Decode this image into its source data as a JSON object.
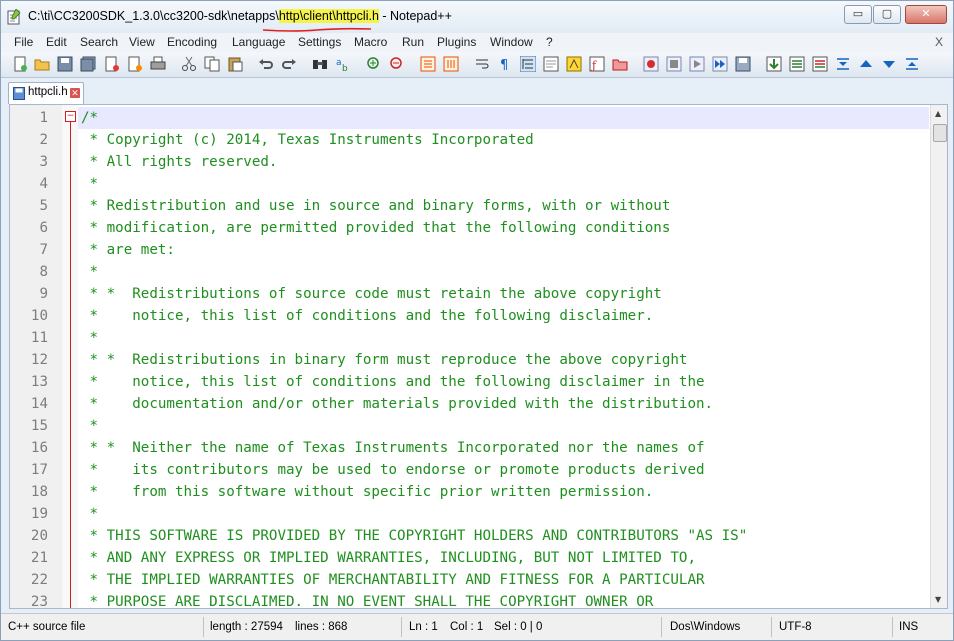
{
  "window": {
    "title_prefix": "C:\\ti\\CC3200SDK_1.3.0\\cc3200-sdk\\netapps\\",
    "title_highlight": "http\\client\\httpcli.h",
    "title_suffix": " - Notepad++",
    "controls": {
      "minimize": "▭",
      "maximize": "▢",
      "close": "✕"
    }
  },
  "menu": {
    "items": [
      "File",
      "Edit",
      "Search",
      "View",
      "Encoding",
      "Language",
      "Settings",
      "Macro",
      "Run",
      "Plugins",
      "Window",
      "?"
    ],
    "close_label": "X"
  },
  "tab": {
    "label": "httpcli.h",
    "close": "✕"
  },
  "editor": {
    "fold_marker": "−",
    "lines": [
      {
        "n": "1",
        "text": "/*"
      },
      {
        "n": "2",
        "text": " * Copyright (c) 2014, Texas Instruments Incorporated"
      },
      {
        "n": "3",
        "text": " * All rights reserved."
      },
      {
        "n": "4",
        "text": " *"
      },
      {
        "n": "5",
        "text": " * Redistribution and use in source and binary forms, with or without"
      },
      {
        "n": "6",
        "text": " * modification, are permitted provided that the following conditions"
      },
      {
        "n": "7",
        "text": " * are met:"
      },
      {
        "n": "8",
        "text": " *"
      },
      {
        "n": "9",
        "text": " * *  Redistributions of source code must retain the above copyright"
      },
      {
        "n": "10",
        "text": " *    notice, this list of conditions and the following disclaimer."
      },
      {
        "n": "11",
        "text": " *"
      },
      {
        "n": "12",
        "text": " * *  Redistributions in binary form must reproduce the above copyright"
      },
      {
        "n": "13",
        "text": " *    notice, this list of conditions and the following disclaimer in the"
      },
      {
        "n": "14",
        "text": " *    documentation and/or other materials provided with the distribution."
      },
      {
        "n": "15",
        "text": " *"
      },
      {
        "n": "16",
        "text": " * *  Neither the name of Texas Instruments Incorporated nor the names of"
      },
      {
        "n": "17",
        "text": " *    its contributors may be used to endorse or promote products derived"
      },
      {
        "n": "18",
        "text": " *    from this software without specific prior written permission."
      },
      {
        "n": "19",
        "text": " *"
      },
      {
        "n": "20",
        "text": " * THIS SOFTWARE IS PROVIDED BY THE COPYRIGHT HOLDERS AND CONTRIBUTORS \"AS IS\""
      },
      {
        "n": "21",
        "text": " * AND ANY EXPRESS OR IMPLIED WARRANTIES, INCLUDING, BUT NOT LIMITED TO,"
      },
      {
        "n": "22",
        "text": " * THE IMPLIED WARRANTIES OF MERCHANTABILITY AND FITNESS FOR A PARTICULAR"
      },
      {
        "n": "23",
        "text": " * PURPOSE ARE DISCLAIMED. IN NO EVENT SHALL THE COPYRIGHT OWNER OR"
      }
    ]
  },
  "status": {
    "file_type": "C++ source file",
    "length": "length : 27594",
    "lines": "lines : 868",
    "ln": "Ln : 1",
    "col": "Col : 1",
    "sel": "Sel : 0 | 0",
    "eol": "Dos\\Windows",
    "encoding": "UTF-8",
    "mode": "INS"
  },
  "colors": {
    "comment": "#1f8f1f",
    "line_number": "#7d7d7d",
    "current_line": "#e8e8ff",
    "title_highlight": "#f4f34a",
    "fold_marker": "#d21e1e"
  }
}
